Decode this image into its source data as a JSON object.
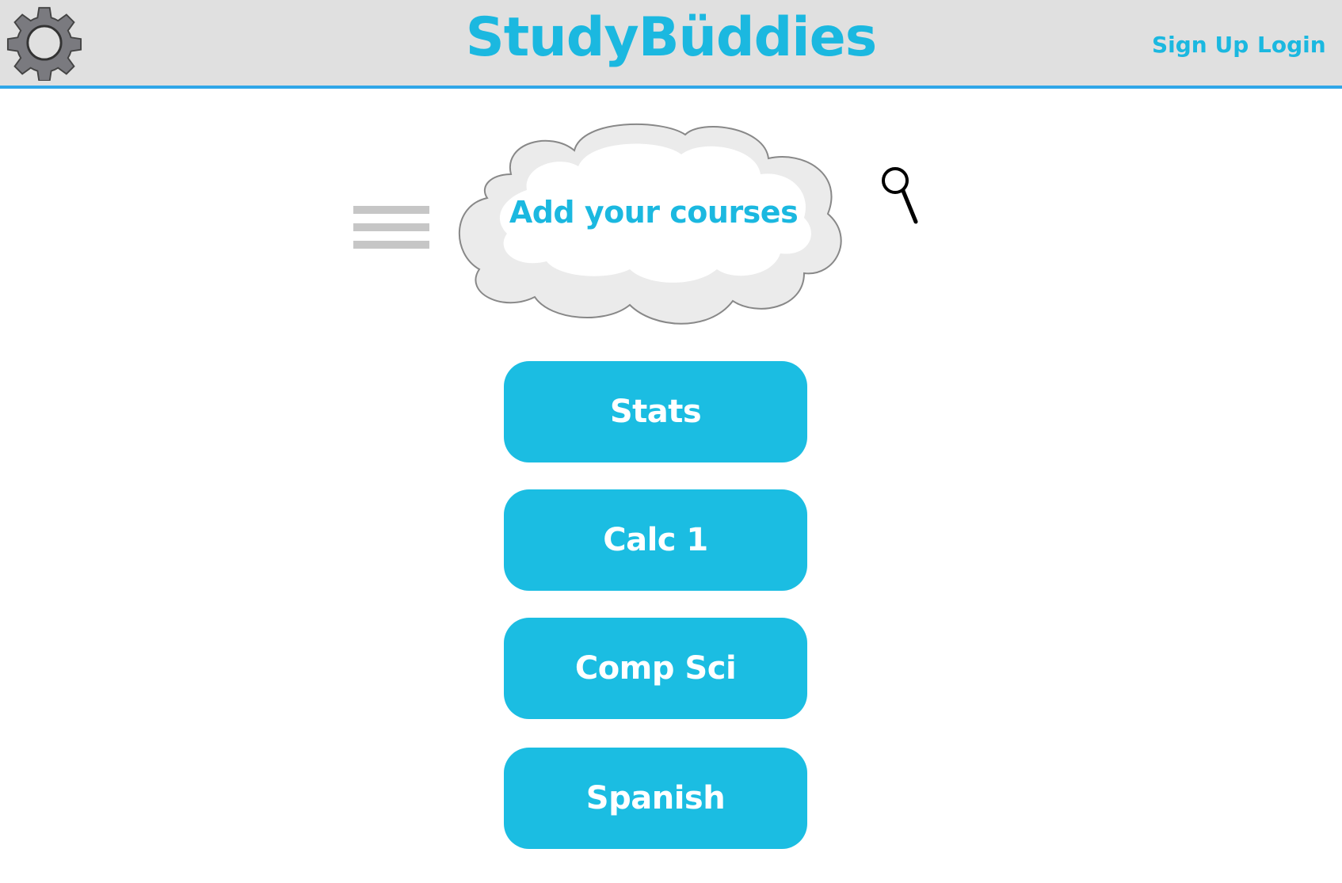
{
  "header": {
    "brand": "StudyBüddies",
    "nav": {
      "signup_label": "Sign Up",
      "login_label": "Login"
    },
    "settings_icon": "gear-icon"
  },
  "main": {
    "cloud_title": "Add your courses",
    "menu_icon": "hamburger-menu-icon",
    "search_icon": "magnifier-icon",
    "courses": [
      {
        "label": "Stats"
      },
      {
        "label": "Calc 1"
      },
      {
        "label": "Comp Sci"
      },
      {
        "label": "Spanish"
      }
    ]
  },
  "colors": {
    "accent": "#1bb8e0",
    "button": "#1bbde2",
    "header_bg": "#e0e0e0",
    "header_border": "#2fa6e8",
    "menu_lines": "#c6c6c6",
    "gear": "#7a7a7f"
  }
}
